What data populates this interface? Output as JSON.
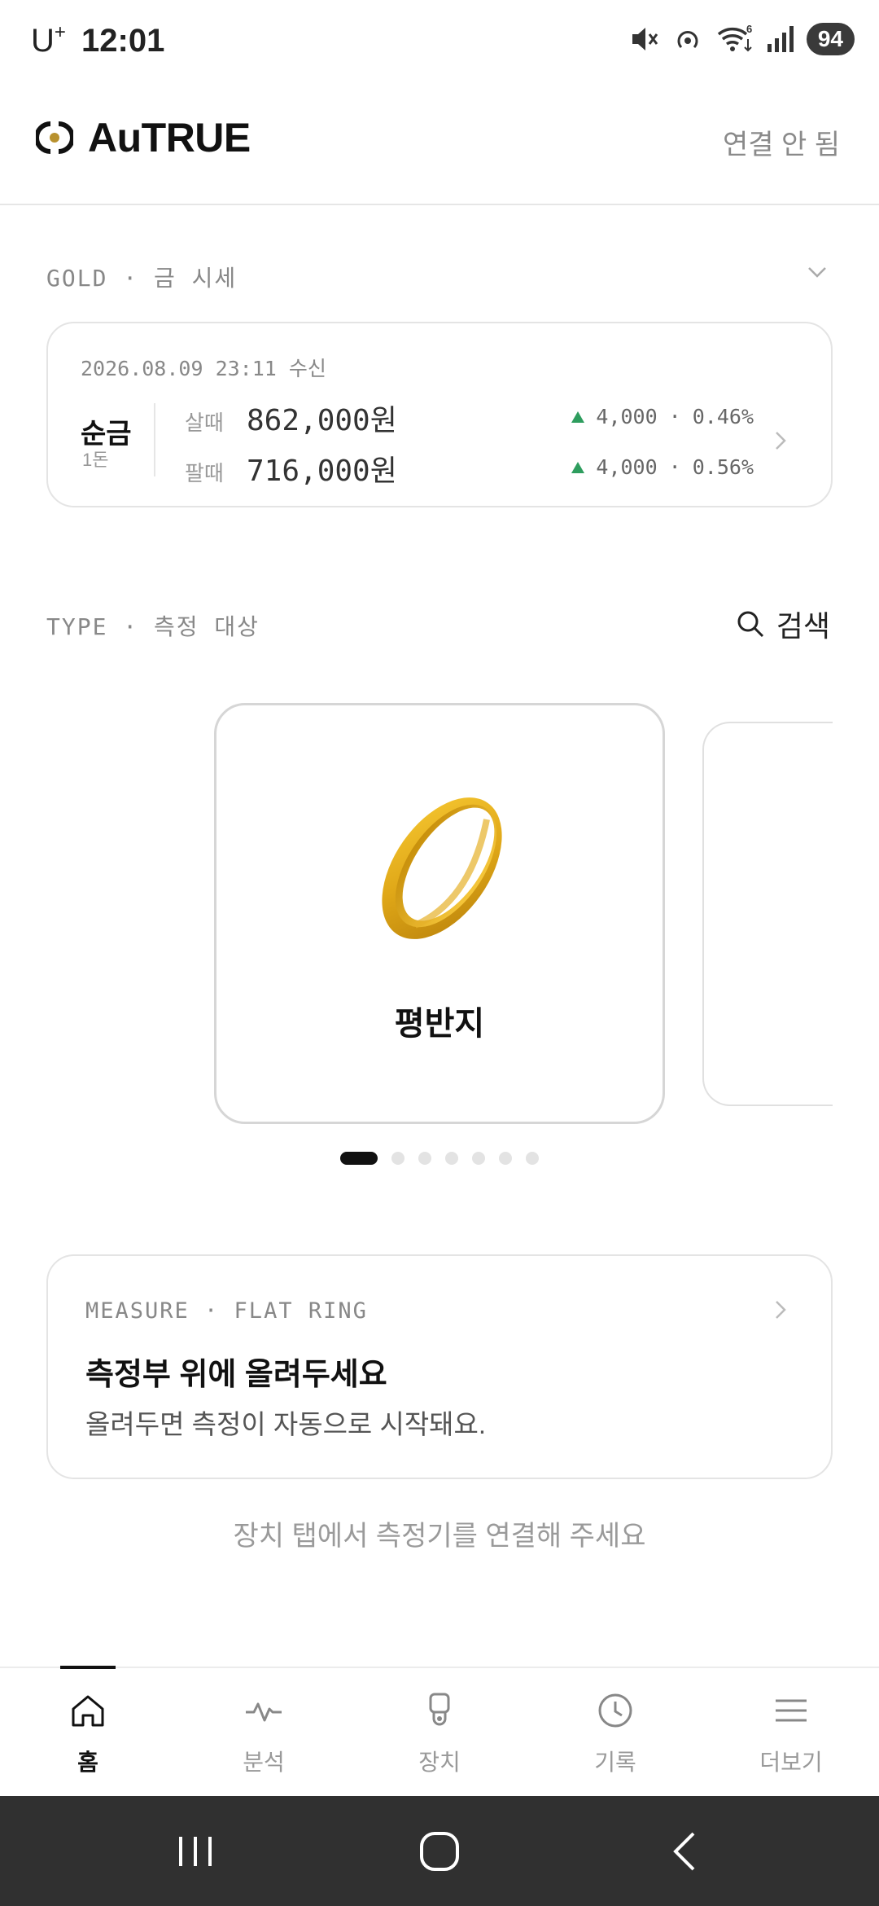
{
  "status_bar": {
    "carrier": "U",
    "carrier_sup": "+",
    "time": "12:01",
    "battery": "94",
    "network": "6"
  },
  "header": {
    "app_name": "AuTRUE",
    "connection_status": "연결 안 됨"
  },
  "gold_section": {
    "label": "GOLD · 금 시세",
    "received_at": "2026.08.09 23:11 수신",
    "item_name": "순금",
    "item_unit": "1돈",
    "rows": [
      {
        "label": "살때",
        "price": "862,000원",
        "change": "4,000",
        "change_pct": "0.46%",
        "direction": "up"
      },
      {
        "label": "팔때",
        "price": "716,000원",
        "change": "4,000",
        "change_pct": "0.56%",
        "direction": "up"
      }
    ],
    "separator": "·"
  },
  "type_section": {
    "label": "TYPE · 측정 대상",
    "search_label": "검색",
    "current_card": {
      "name": "평반지",
      "image": "gold-ring"
    },
    "total_pages": 7,
    "active_page": 1
  },
  "measure": {
    "label": "MEASURE · FLAT RING",
    "title": "측정부 위에 올려두세요",
    "description": "올려두면 측정이 자동으로 시작돼요."
  },
  "hint": "장치 탭에서 측정기를 연결해 주세요",
  "nav": {
    "items": [
      {
        "label": "홈",
        "icon": "home-icon",
        "active": true
      },
      {
        "label": "분석",
        "icon": "pulse-icon",
        "active": false
      },
      {
        "label": "장치",
        "icon": "device-icon",
        "active": false
      },
      {
        "label": "기록",
        "icon": "clock-icon",
        "active": false
      },
      {
        "label": "더보기",
        "icon": "menu-icon",
        "active": false
      }
    ]
  },
  "colors": {
    "up": "#2e9d5e",
    "accent": "#111111",
    "muted": "#888888",
    "gold": "#e0a818"
  }
}
